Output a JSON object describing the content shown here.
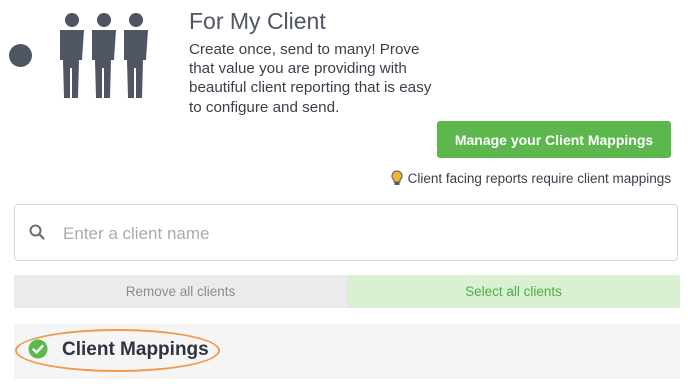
{
  "header": {
    "title": "For My Client",
    "description": "Create once, send to many! Prove that value you are providing with beautiful client reporting that is easy to configure and send."
  },
  "icons": {
    "people": "people-group-icon",
    "radio": "radio-dot-icon",
    "lightbulb": "lightbulb-icon",
    "search": "search-icon",
    "check": "check-circle-icon"
  },
  "actions": {
    "manage_label": "Manage your Client Mappings",
    "hint_text": "Client facing reports require client mappings"
  },
  "search": {
    "placeholder": "Enter a client name",
    "value": ""
  },
  "bulk": {
    "remove_label": "Remove all clients",
    "select_label": "Select all clients"
  },
  "section": {
    "title": "Client Mappings"
  },
  "colors": {
    "accent_green": "#5cb84c",
    "text_dark": "#4f5563",
    "highlight_orange": "#ef9a4f",
    "select_bg": "#d9f0d3"
  }
}
